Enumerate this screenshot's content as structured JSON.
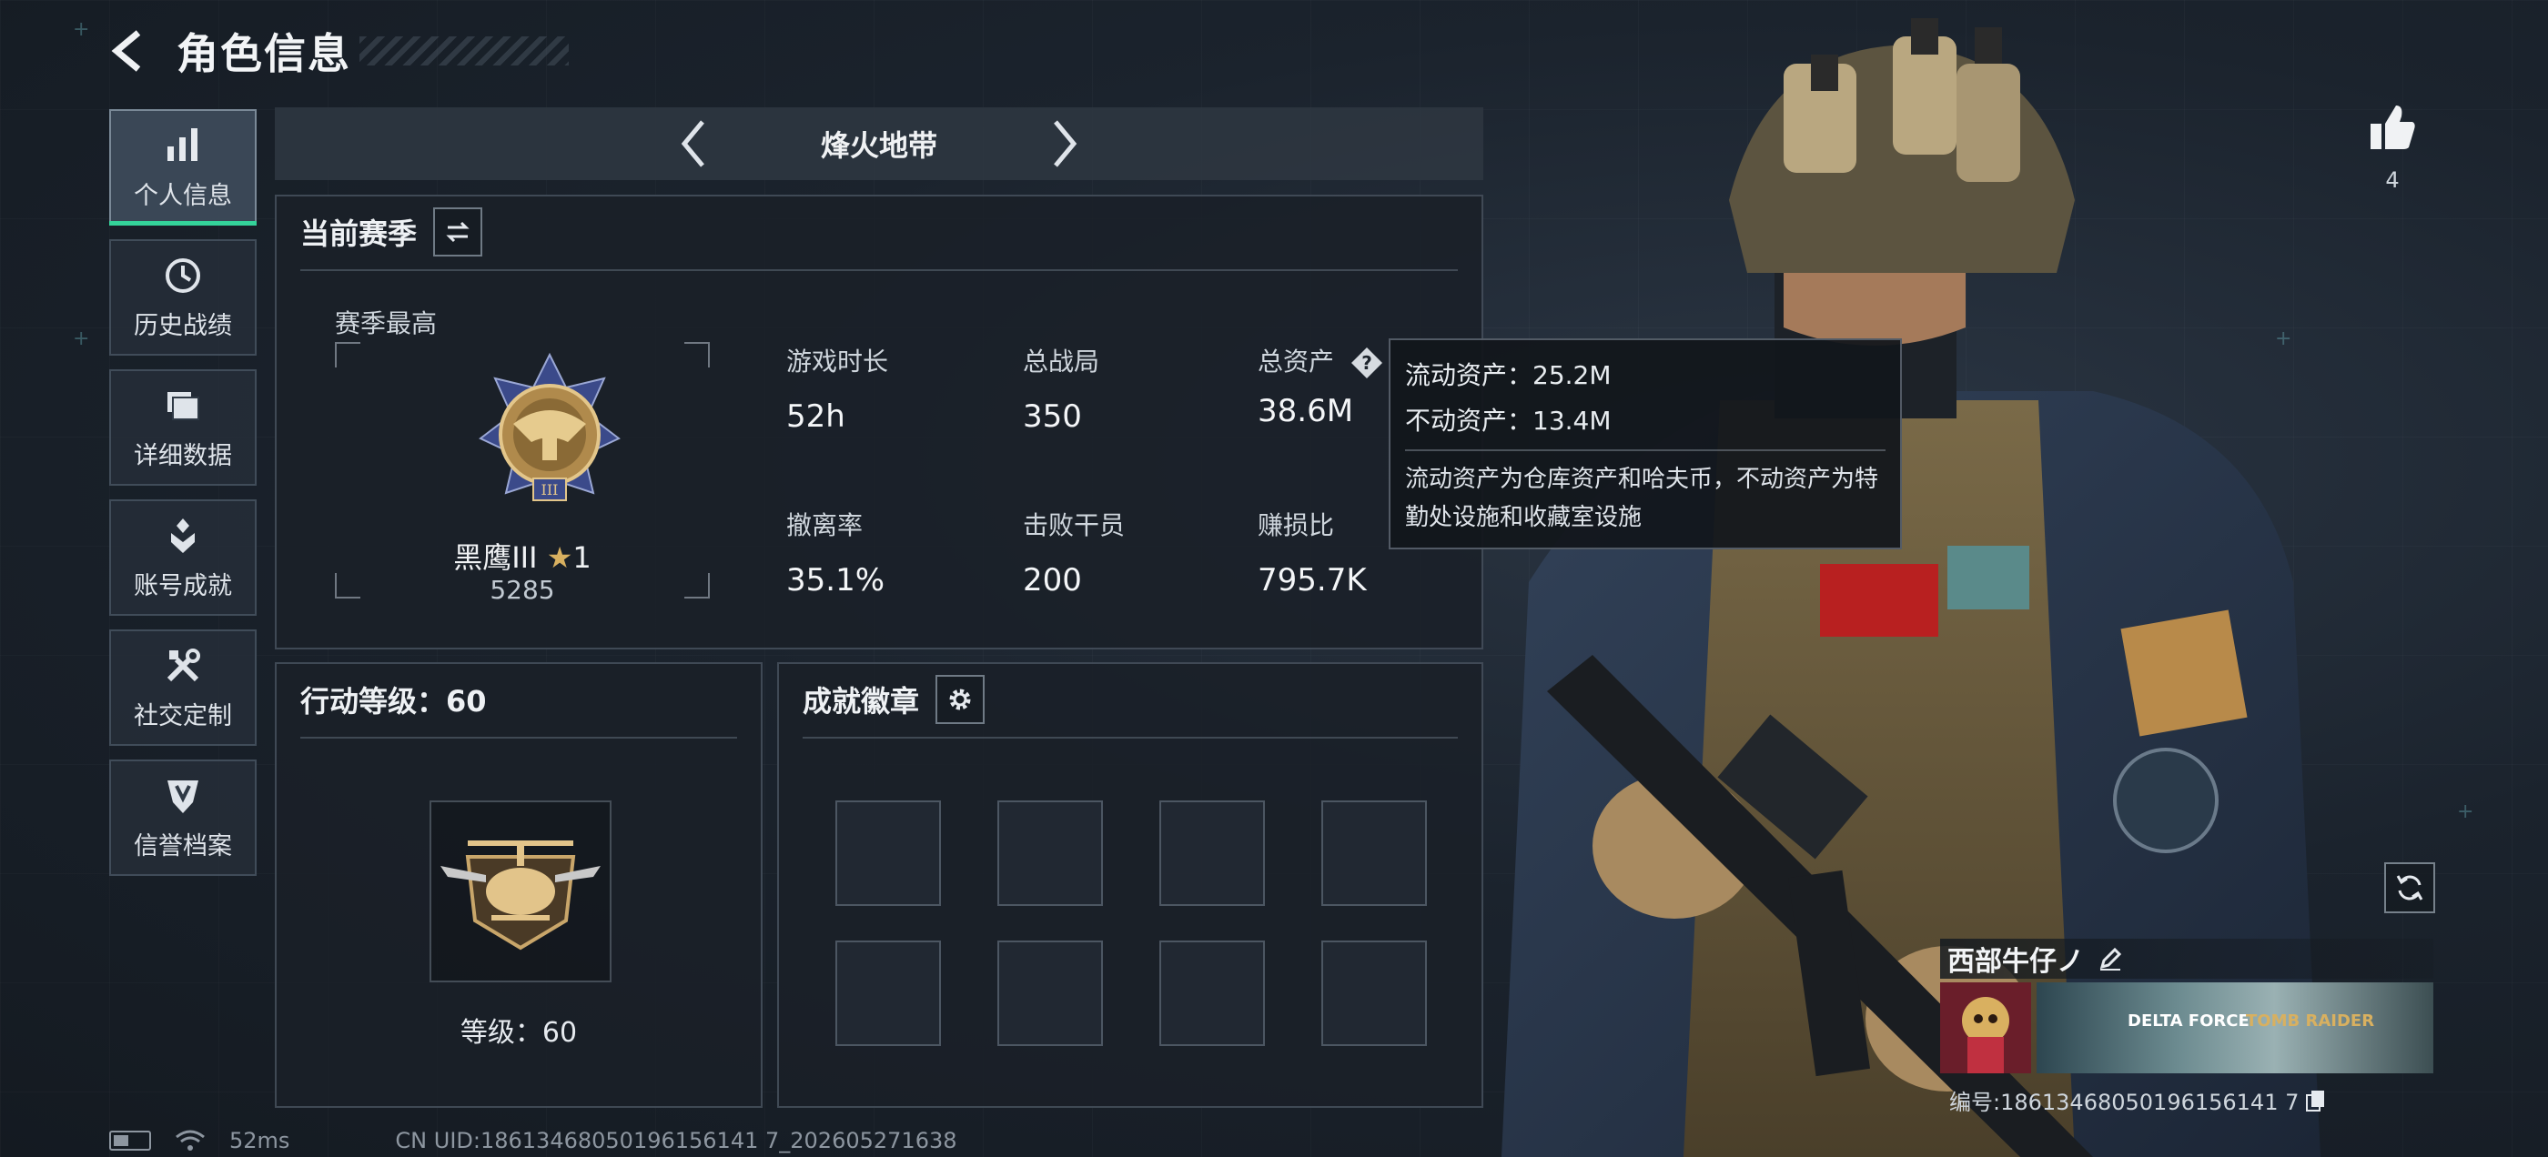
{
  "header": {
    "title": "角色信息"
  },
  "sidebar": {
    "items": [
      {
        "label": "个人信息",
        "icon": "bar-chart-icon",
        "active": true
      },
      {
        "label": "历史战绩",
        "icon": "history-icon",
        "active": false
      },
      {
        "label": "详细数据",
        "icon": "folder-icon",
        "active": false
      },
      {
        "label": "账号成就",
        "icon": "achievement-icon",
        "active": false
      },
      {
        "label": "社交定制",
        "icon": "tools-icon",
        "active": false
      },
      {
        "label": "信誉档案",
        "icon": "shield-icon",
        "active": false
      }
    ]
  },
  "mode": {
    "name": "烽火地带"
  },
  "season": {
    "title": "当前赛季",
    "best_label": "赛季最高",
    "rank_name": "黑鹰III",
    "rank_stars": "1",
    "rank_score": "5285",
    "stats": [
      {
        "label": "游戏时长",
        "value": "52h"
      },
      {
        "label": "总战局",
        "value": "350"
      },
      {
        "label": "总资产",
        "value": "38.6M"
      },
      {
        "label": "撤离率",
        "value": "35.1%"
      },
      {
        "label": "击败干员",
        "value": "200"
      },
      {
        "label": "赚损比",
        "value": "795.7K"
      }
    ]
  },
  "tooltip": {
    "liquid": "流动资产：25.2M",
    "fixed": "不动资产：13.4M",
    "description": "流动资产为仓库资产和哈夫币，不动资产为特勤处设施和收藏室设施"
  },
  "level": {
    "title": "行动等级：60",
    "text": "等级：60"
  },
  "achievements": {
    "title": "成就徽章"
  },
  "like": {
    "count": "4"
  },
  "player": {
    "name": "西部牛仔ノ",
    "uid": "编号:18613468050196156141 7",
    "banner_logo_1": "DELTA FORCE",
    "banner_logo_2": "TOMB RAIDER"
  },
  "status": {
    "ping": "52ms",
    "uid_footer": "CN UID:18613468050196156141 7_202605271638",
    "battery_level": 0.45
  },
  "colors": {
    "accent": "#34d39a",
    "gold": "#d8b060"
  }
}
